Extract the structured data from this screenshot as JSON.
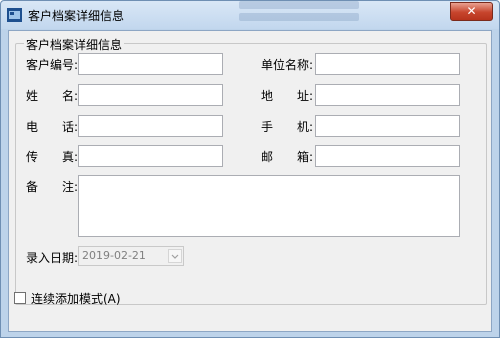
{
  "window": {
    "title": "客户档案详细信息",
    "close_label": "✕"
  },
  "group": {
    "title": "客户档案详细信息"
  },
  "fields": {
    "customer_no": {
      "label": "客户编号:",
      "value": ""
    },
    "company": {
      "label": "单位名称:",
      "value": ""
    },
    "name": {
      "label": "姓　　名:",
      "value": ""
    },
    "address": {
      "label": "地　　址:",
      "value": ""
    },
    "phone": {
      "label": "电　　话:",
      "value": ""
    },
    "mobile": {
      "label": "手　　机:",
      "value": ""
    },
    "fax": {
      "label": "传　　真:",
      "value": ""
    },
    "email": {
      "label": "邮　　箱:",
      "value": ""
    },
    "remark": {
      "label": "备　　注:",
      "value": ""
    },
    "entry_date": {
      "label": "录入日期:",
      "value": "2019-02-21"
    }
  },
  "continuous_add": {
    "label": "连续添加模式(A)",
    "checked": false
  }
}
